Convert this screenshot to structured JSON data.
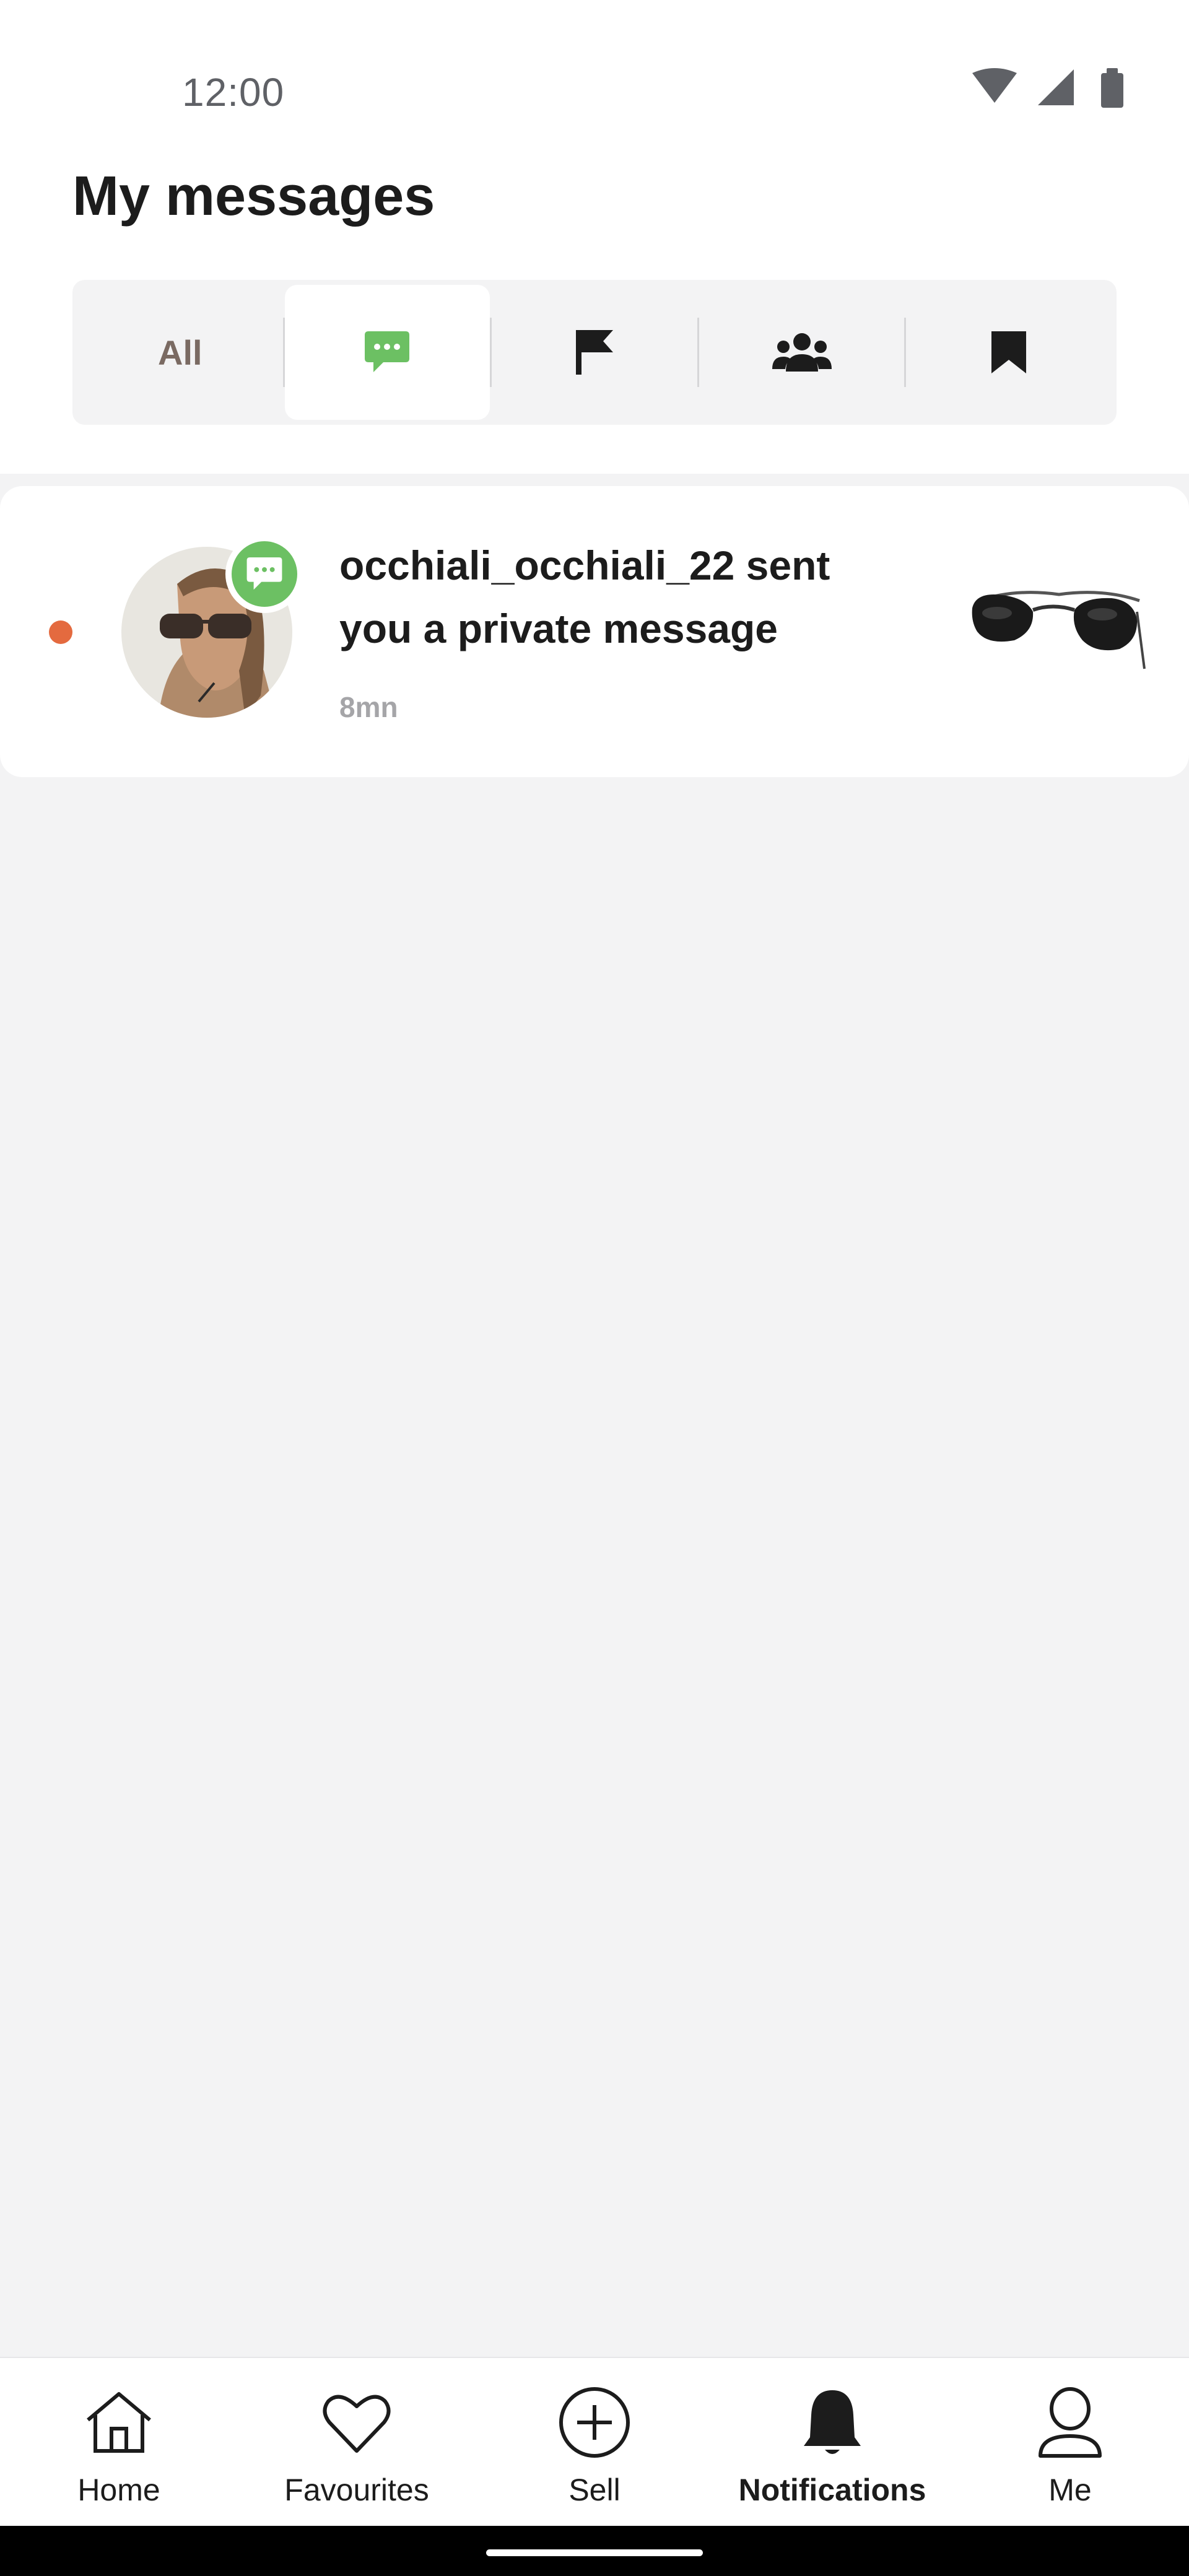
{
  "status_bar": {
    "time": "12:00",
    "icons": [
      "wifi-icon",
      "cellular-signal-icon",
      "battery-icon"
    ]
  },
  "header": {
    "title": "My messages"
  },
  "filter_tabs": [
    {
      "label": "All",
      "active": false
    },
    {
      "icon": "chat-bubble-icon",
      "active": true,
      "color": "#6cc063"
    },
    {
      "icon": "flag-icon",
      "active": false
    },
    {
      "icon": "group-icon",
      "active": false
    },
    {
      "icon": "bookmark-icon",
      "active": false
    }
  ],
  "notifications": [
    {
      "unread": true,
      "unread_color": "#e46a3f",
      "avatar": "user-avatar-photo",
      "badge_icon": "chat-bubble-icon",
      "badge_color": "#6cc063",
      "text": "occhiali_occhiali_22 sent you a private message",
      "time": "8mn",
      "thumbnail": "aviator-sunglasses-image"
    }
  ],
  "bottom_nav": [
    {
      "label": "Home",
      "icon": "home-icon",
      "active": false
    },
    {
      "label": "Favourites",
      "icon": "heart-icon",
      "active": false
    },
    {
      "label": "Sell",
      "icon": "plus-circle-icon",
      "active": false
    },
    {
      "label": "Notifications",
      "icon": "bell-icon",
      "active": true
    },
    {
      "label": "Me",
      "icon": "person-icon",
      "active": false
    }
  ]
}
